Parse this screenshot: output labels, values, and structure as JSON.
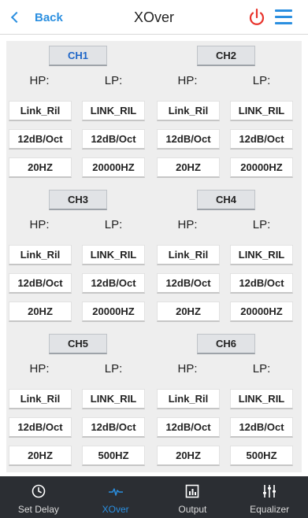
{
  "header": {
    "back_label": "Back",
    "title": "XOver",
    "power_color": "#e8332b",
    "accent": "#2b8fe0"
  },
  "channels": [
    {
      "name": "CH1",
      "active": true,
      "hp_label": "HP:",
      "lp_label": "LP:",
      "hp": {
        "filter": "Link_Ril",
        "slope": "12dB/Oct",
        "freq": "20HZ"
      },
      "lp": {
        "filter": "LINK_RIL",
        "slope": "12dB/Oct",
        "freq": "20000HZ"
      }
    },
    {
      "name": "CH2",
      "active": false,
      "hp_label": "HP:",
      "lp_label": "LP:",
      "hp": {
        "filter": "Link_Ril",
        "slope": "12dB/Oct",
        "freq": "20HZ"
      },
      "lp": {
        "filter": "LINK_RIL",
        "slope": "12dB/Oct",
        "freq": "20000HZ"
      }
    },
    {
      "name": "CH3",
      "active": false,
      "hp_label": "HP:",
      "lp_label": "LP:",
      "hp": {
        "filter": "Link_Ril",
        "slope": "12dB/Oct",
        "freq": "20HZ"
      },
      "lp": {
        "filter": "LINK_RIL",
        "slope": "12dB/Oct",
        "freq": "20000HZ"
      }
    },
    {
      "name": "CH4",
      "active": false,
      "hp_label": "HP:",
      "lp_label": "LP:",
      "hp": {
        "filter": "Link_Ril",
        "slope": "12dB/Oct",
        "freq": "20HZ"
      },
      "lp": {
        "filter": "LINK_RIL",
        "slope": "12dB/Oct",
        "freq": "20000HZ"
      }
    },
    {
      "name": "CH5",
      "active": false,
      "hp_label": "HP:",
      "lp_label": "LP:",
      "hp": {
        "filter": "Link_Ril",
        "slope": "12dB/Oct",
        "freq": "20HZ"
      },
      "lp": {
        "filter": "LINK_RIL",
        "slope": "12dB/Oct",
        "freq": "500HZ"
      }
    },
    {
      "name": "CH6",
      "active": false,
      "hp_label": "HP:",
      "lp_label": "LP:",
      "hp": {
        "filter": "Link_Ril",
        "slope": "12dB/Oct",
        "freq": "20HZ"
      },
      "lp": {
        "filter": "LINK_RIL",
        "slope": "12dB/Oct",
        "freq": "500HZ"
      }
    }
  ],
  "nav": {
    "items": [
      {
        "label": "Set Delay",
        "icon": "clock-icon",
        "active": false
      },
      {
        "label": "XOver",
        "icon": "waveform-icon",
        "active": true
      },
      {
        "label": "Output",
        "icon": "bar-chart-icon",
        "active": false
      },
      {
        "label": "Equalizer",
        "icon": "sliders-icon",
        "active": false
      }
    ]
  }
}
